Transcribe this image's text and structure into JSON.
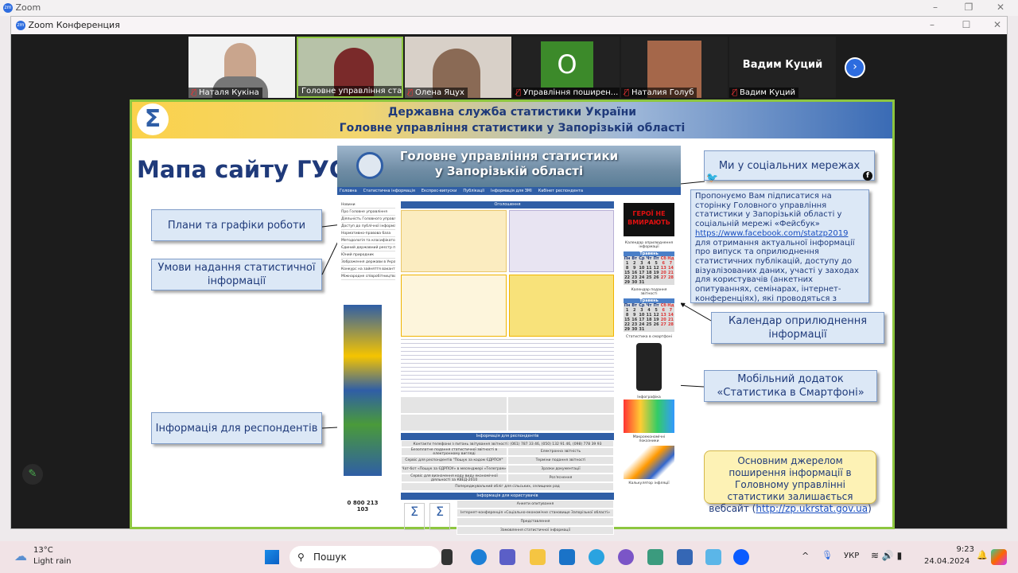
{
  "app": {
    "outer_title": "Zoom",
    "window_title": "Zoom Конференция"
  },
  "participants": [
    {
      "name": "Наталя Кукіна",
      "muted": true
    },
    {
      "name": "Головне управління стат...",
      "muted": false
    },
    {
      "name": "Олена Яцух",
      "muted": true
    },
    {
      "name": "Управління поширен...",
      "muted": true,
      "initial": "О"
    },
    {
      "name": "Наталия Голуб",
      "muted": true
    },
    {
      "name": "Вадим Куций",
      "muted": true,
      "big_label": "Вадим Куций"
    }
  ],
  "slide": {
    "header_line1": "Державна служба статистики України",
    "header_line2": "Головне управління статистики у Запорізькій області",
    "title": "Мапа сайту ГУС",
    "callouts": {
      "plans": "Плани та графіки роботи",
      "conditions": "Умови надання статистичної інформації",
      "respondents": "Інформація для респондентів",
      "social": "Ми у соціальних мережах",
      "calendar": "Календар оприлюднення інформації",
      "mobile": "Мобільний додаток «Статистика в Смартфоні»"
    },
    "facebook_text_before": "Пропонуємо Вам підписатися на сторінку Головного управління статистики у Запорізькій області у соціальній мережі «Фейсбук»",
    "facebook_link": "https://www.facebook.com/statzp2019",
    "facebook_text_after": "для отримання актуальної інформації про випуск та оприлюднення статистичних публікацій, доступу до візуалізованих даних, участі у заходах для користувачів (анкетних опитуваннях, семінарах, інтернет-конференціях), які проводяться з метою удосконалення державних статистичних спостережень, підвищення рівня статистичної грамотності",
    "website_note_before": "Основним джерелом поширення інформації в Головному управлінні статистики залишається вебсайт (",
    "website_link": "http://zp.ukrstat.gov.ua",
    "website_note_after": ")"
  },
  "site": {
    "banner_line1": "Головне управління статистики",
    "banner_line2": "у Запорізькій області",
    "nav": [
      "Головна",
      "Статистична інформація",
      "Експрес-випуски",
      "Публікації",
      "Інформація для ЗМІ",
      "Кабінет респондента"
    ],
    "menu": [
      "Новини",
      "Про Головне управління",
      "Діяльність Головного управління",
      "Доступ до публічної інформації",
      "Нормативно-правова база",
      "Методологія та класифікатори",
      "Єдиний державний реєстр підприємств і організацій України",
      "Юний природник",
      "Зображення держави в Україні",
      "Конкурс на зайняття вакантних посад",
      "Міжнародне співробітництво"
    ],
    "announce": "Оголошення",
    "respondents_header": "Інформація для респондентів",
    "phones": "Контакти телефони з питань звітування звітності: (061) 787 33 46, (050) 132 91 46, (098) 778 39 93",
    "resp_rows": [
      [
        "Безоплатне подання статистичної звітності в електронному вигляді",
        "Електронна звітність"
      ],
      [
        "Сервіс для респондентів \"Пошук за кодом ЄДРПОУ\"",
        "Терміни подання звітності"
      ],
      [
        "Чат-бот «Пошук за ЄДРПОУ» в месенджері «Телеграм»",
        "Зразки документації"
      ],
      [
        "Сервіс для визначення коду виду економічної діяльності за КВЕД-2010",
        "Роз'яснення"
      ]
    ],
    "resp_footer": "Попереджувальний обліг для сільських, селищних рад",
    "users_header": "Інформація для користувачів",
    "users_rows": [
      "Анкети опитування",
      "Інтернет-конференція «Соціально-економічне становище Запорізької області»",
      "Представлення",
      "Замовлення статистичної інформації"
    ],
    "heroes": "ГЕРОЇ НЕ ВМИРАЮТЬ",
    "right_labels": [
      "Календар оприлюднення інформації",
      "Календар подання звітності",
      "Статистика в смартфоні",
      "Інфографіка",
      "Макроекономічні показники",
      "Калькулятор інфляції"
    ],
    "calendar_month": "Травень",
    "weekdays": [
      "Пн",
      "Вт",
      "Ср",
      "Чт",
      "Пт",
      "Сб",
      "Нд"
    ],
    "hotline": "0 800 213 103"
  },
  "taskbar": {
    "temp": "13°C",
    "weather": "Light rain",
    "search": "Пошук",
    "lang": "УКР",
    "time": "9:23",
    "date": "24.04.2024"
  },
  "colors": {
    "accent": "#2f5ea6",
    "slide_border": "#8dc63f"
  }
}
